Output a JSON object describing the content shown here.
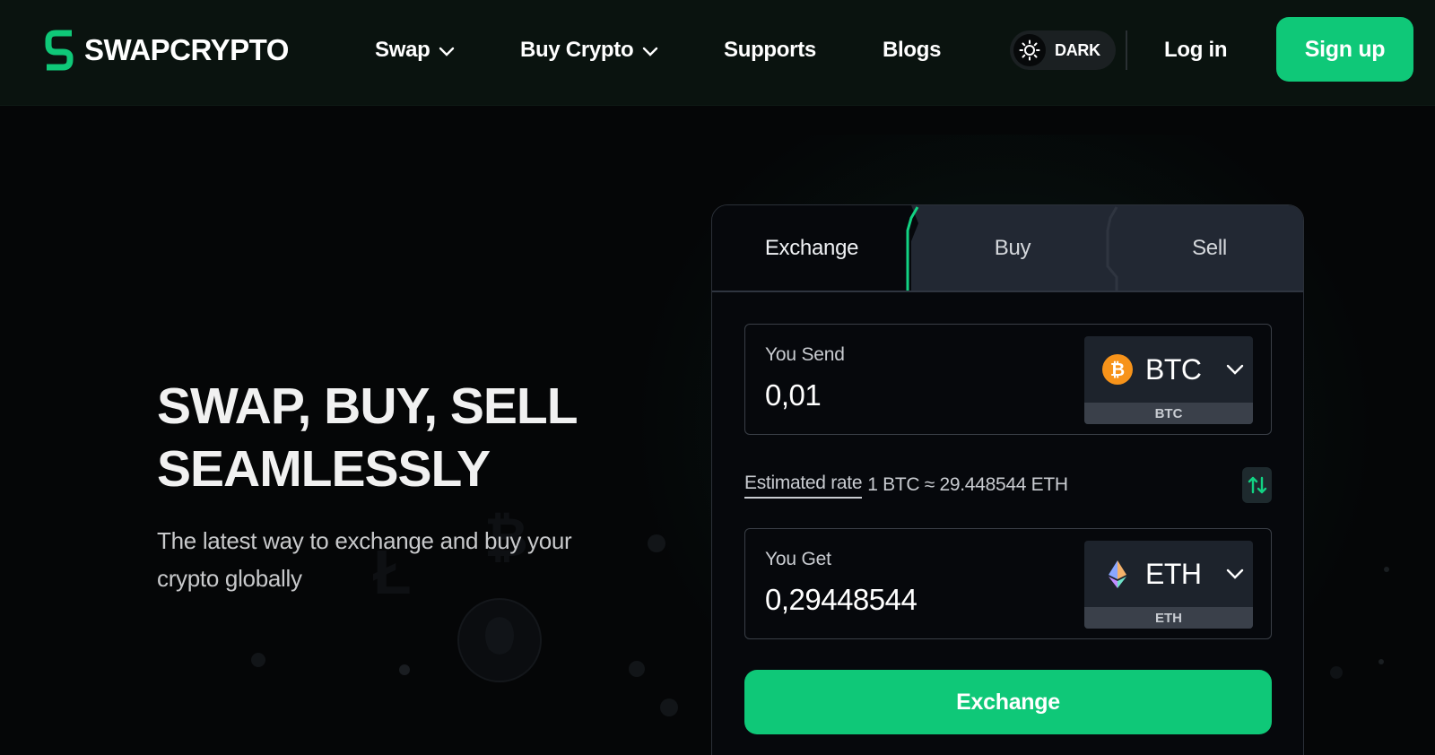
{
  "brand": {
    "name": "SWAPCRYPTO",
    "accent": "#0fc878"
  },
  "nav": {
    "items": [
      {
        "label": "Swap",
        "has_dropdown": true
      },
      {
        "label": "Buy Crypto",
        "has_dropdown": true
      },
      {
        "label": "Supports",
        "has_dropdown": false
      },
      {
        "label": "Blogs",
        "has_dropdown": false
      }
    ],
    "theme_label": "DARK",
    "login_label": "Log in",
    "signup_label": "Sign up"
  },
  "hero": {
    "title_line1": "SWAP, BUY, SELL",
    "title_line2": "SEAMLESSLY",
    "subtitle": "The latest way to exchange and buy your crypto globally"
  },
  "exchange_card": {
    "tabs": [
      {
        "label": "Exchange",
        "active": true
      },
      {
        "label": "Buy",
        "active": false
      },
      {
        "label": "Sell",
        "active": false
      }
    ],
    "send": {
      "label": "You Send",
      "value": "0,01",
      "coin": "BTC",
      "network": "BTC",
      "icon": "bitcoin-icon",
      "icon_color": "#f7931a"
    },
    "rate": {
      "link_label": "Estimated rate",
      "text": "1 BTC ≈ 29.448544 ETH"
    },
    "get": {
      "label": "You Get",
      "value": "0,29448544",
      "coin": "ETH",
      "network": "ETH",
      "icon": "ethereum-icon"
    },
    "submit_label": "Exchange"
  }
}
